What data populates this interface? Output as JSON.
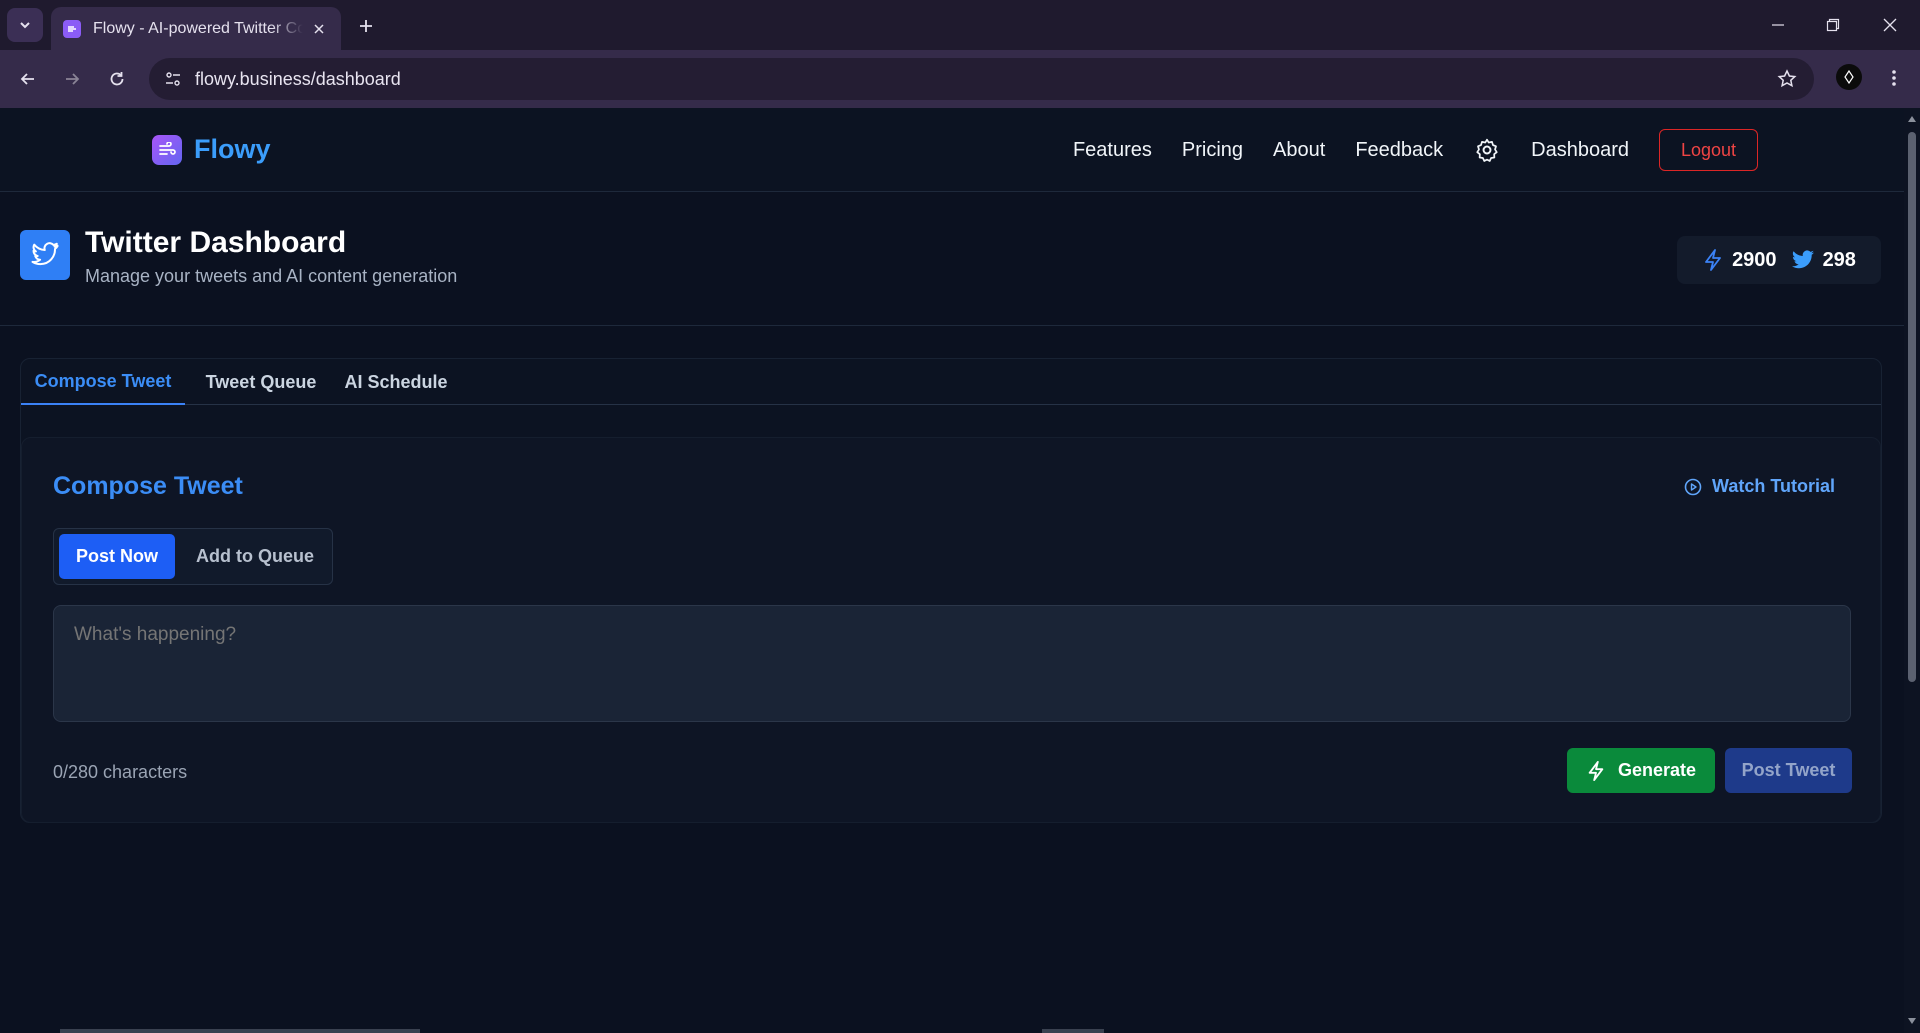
{
  "browser": {
    "tab_title": "Flowy - AI-powered Twitter Content",
    "url": "flowy.business/dashboard"
  },
  "site": {
    "brand": "Flowy",
    "nav": {
      "features": "Features",
      "pricing": "Pricing",
      "about": "About",
      "feedback": "Feedback",
      "dashboard": "Dashboard",
      "logout": "Logout"
    }
  },
  "dashboard": {
    "title": "Twitter Dashboard",
    "subtitle": "Manage your tweets and AI content generation",
    "stats": {
      "credits": "2900",
      "tweets": "298"
    }
  },
  "tabs": {
    "compose": "Compose Tweet",
    "queue": "Tweet Queue",
    "schedule": "AI Schedule"
  },
  "compose": {
    "title": "Compose Tweet",
    "tutorial": "Watch Tutorial",
    "mode_post_now": "Post Now",
    "mode_queue": "Add to Queue",
    "placeholder": "What's happening?",
    "char_count": "0/280 characters",
    "generate": "Generate",
    "post": "Post Tweet"
  },
  "colors": {
    "accent": "#3b82f6",
    "generate": "#0a8a3b",
    "logout": "#ef4444",
    "background": "#0b1120"
  }
}
